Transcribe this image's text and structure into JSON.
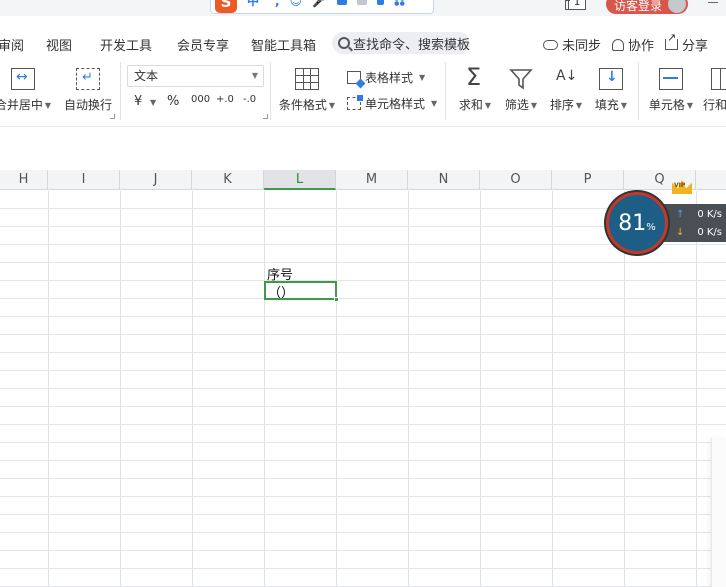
{
  "topbar": {
    "ime_logo": "S",
    "ime_items": [
      "中",
      "°,",
      "☺",
      "🎤"
    ],
    "window_count": "1",
    "login_label": "访客登录"
  },
  "menu": {
    "tabs": [
      "审阅",
      "视图",
      "开发工具",
      "会员专享",
      "智能工具箱"
    ],
    "search_placeholder": "查找命令、搜索模板",
    "unsync": "未同步",
    "collab": "协作",
    "share": "分享"
  },
  "ribbon": {
    "merge": "合并居中",
    "wrap": "自动换行",
    "number_format": "文本",
    "currency": "¥",
    "percent": "%",
    "thousands": "000",
    "dec_inc": "+.0",
    "dec_dec": "-.0",
    "cond_format": "条件格式",
    "table_style": "表格样式",
    "cell_style": "单元格样式",
    "sum": "求和",
    "filter": "筛选",
    "sort": "排序",
    "fill": "填充",
    "cell": "单元格",
    "rowcol": "行和"
  },
  "grid": {
    "columns": [
      "H",
      "I",
      "J",
      "K",
      "L",
      "M",
      "N",
      "O",
      "P",
      "Q"
    ],
    "active_column": "L",
    "cells": {
      "header_text": "序号",
      "selected_text": "（）"
    }
  },
  "speed_widget": {
    "percent": "81",
    "percent_sign": "%",
    "upload": "0 K/s",
    "download": "0 K/s",
    "badge": "VIP"
  },
  "colors": {
    "accent_green": "#3f9a4c",
    "login_red": "#d9564d",
    "ime_orange": "#ef5a24",
    "icon_blue": "#2f7de1"
  }
}
